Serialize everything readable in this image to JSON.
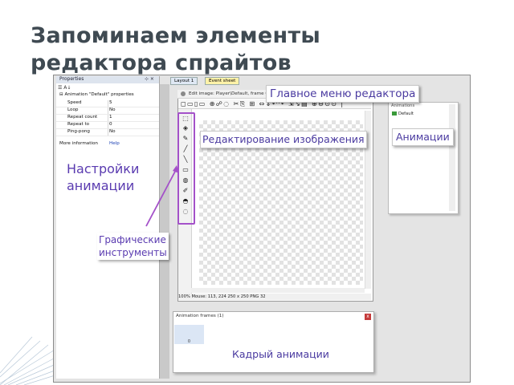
{
  "slide": {
    "title_line1": "Запоминаем элементы",
    "title_line2": "редактора спрайтов"
  },
  "properties_panel": {
    "header": "Properties",
    "category": "Animation \"Default\" properties",
    "rows": [
      {
        "key": "Speed",
        "value": "5"
      },
      {
        "key": "Loop",
        "value": "No"
      },
      {
        "key": "Repeat count",
        "value": "1"
      },
      {
        "key": "Repeat to",
        "value": "0"
      },
      {
        "key": "Ping-pong",
        "value": "No"
      }
    ],
    "more_key": "More information",
    "more_value": "Help"
  },
  "tabs": [
    {
      "label": "Layout 1"
    },
    {
      "label": "Event sheet"
    }
  ],
  "image_editor": {
    "title": "Edit image: Player\\Default, frame 0",
    "toolbar_glyphs": "◻▭▯▭ ⊕☍◌ ✂⎘ ⊞ ⇔⇕↶↷ ⇲↘▤ ⊕⊖⊙⊙ |",
    "status": "100%  Mouse: 113, 224        250 x 250  PNG 32"
  },
  "tools": [
    "⬚",
    "◈",
    "✎",
    "╱",
    "╲",
    "▭",
    "◍",
    "✐",
    "◓",
    "◌",
    "◔"
  ],
  "animations_panel": {
    "label": "Animations",
    "item": "Default"
  },
  "frames_panel": {
    "title": "Animation frames (1)",
    "close": "x",
    "thumb_label": "0"
  },
  "callouts": {
    "main_menu": "Главное меню редактора",
    "animations": "Анимации",
    "image_editing": "Редактирование изображения",
    "frames": "Кадрый анимации",
    "animation_settings_line1": "Настройки",
    "animation_settings_line2": "анимации",
    "graphic_tools_line1": "Графические",
    "graphic_tools_line2": "инструменты"
  },
  "colors": {
    "callout_text": "#4a3aa0",
    "highlight": "#a451c9",
    "title": "#3f4a52"
  }
}
